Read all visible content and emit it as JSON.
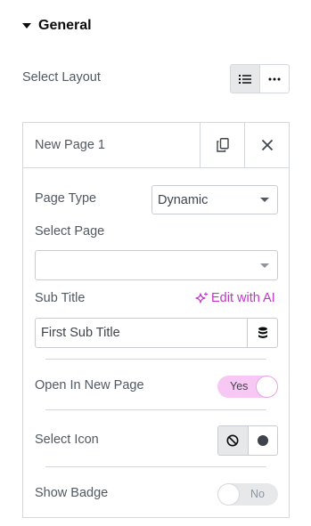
{
  "section": {
    "title": "General"
  },
  "layout": {
    "label": "Select Layout"
  },
  "repeater": {
    "item_title": "New Page 1",
    "page_type": {
      "label": "Page Type",
      "value": "Dynamic"
    },
    "select_page": {
      "label": "Select Page",
      "value": ""
    },
    "sub_title": {
      "label": "Sub Title",
      "ai_link": "Edit with AI",
      "value": "First Sub Title"
    },
    "open_new_page": {
      "label": "Open In New Page",
      "toggle": "Yes"
    },
    "select_icon": {
      "label": "Select Icon"
    },
    "show_badge": {
      "label": "Show Badge",
      "toggle": "No"
    }
  },
  "colors": {
    "accent": "#c035c8",
    "toggle_on": "#f8c8f4",
    "toggle_off": "#e6e8ea",
    "border": "#d5d8dc"
  },
  "icons": [
    "caret-down-icon",
    "list-icon",
    "more-icon",
    "copy-icon",
    "close-icon",
    "sparkle-icon",
    "database-icon",
    "ban-icon",
    "circle-icon"
  ]
}
